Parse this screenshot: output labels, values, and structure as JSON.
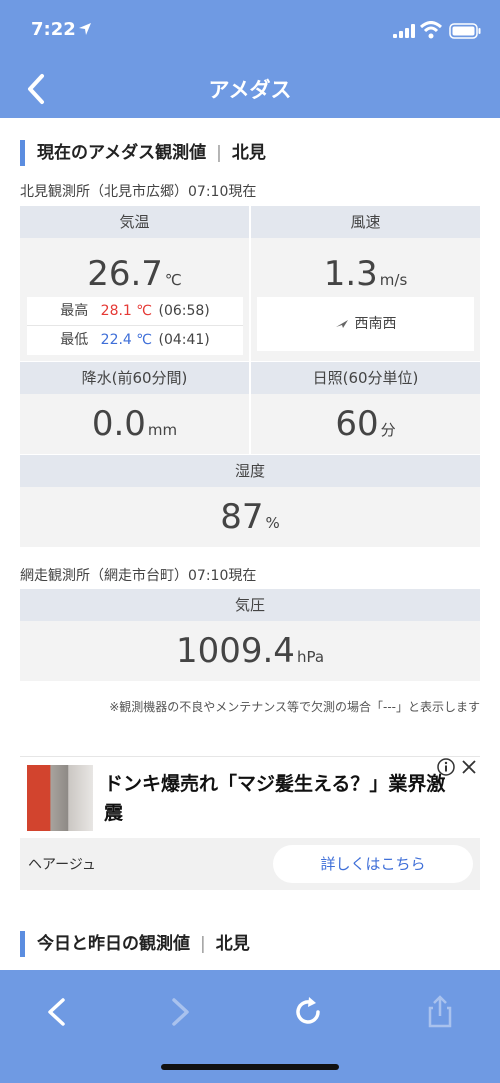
{
  "status_bar": {
    "time": "7:22"
  },
  "nav": {
    "title": "アメダス"
  },
  "current": {
    "heading": "現在のアメダス観測値",
    "separator": "|",
    "city": "北見",
    "station": "北見観測所（北見市広郷）07:10現在",
    "temperature": {
      "label": "気温",
      "value": "26.7",
      "unit": "℃",
      "high_label": "最高",
      "high_value": "28.1 ℃",
      "high_time": "(06:58)",
      "low_label": "最低",
      "low_value": "22.4 ℃",
      "low_time": "(04:41)"
    },
    "wind": {
      "label": "風速",
      "value": "1.3",
      "unit": "m/s",
      "direction": "西南西"
    },
    "precip": {
      "label": "降水(前60分間)",
      "value": "0.0",
      "unit": "mm"
    },
    "sunshine": {
      "label": "日照(60分単位)",
      "value": "60",
      "unit": "分"
    },
    "humidity": {
      "label": "湿度",
      "value": "87",
      "unit": "%"
    },
    "pressure_station": "網走観測所（網走市台町）07:10現在",
    "pressure": {
      "label": "気圧",
      "value": "1009.4",
      "unit": "hPa"
    },
    "note": "※観測機器の不良やメンテナンス等で欠測の場合「---」と表示します"
  },
  "ad": {
    "headline": "ドンキ爆売れ「マジ髪生える？」業界激震",
    "advertiser": "ヘアージュ",
    "cta": "詳しくはこちら"
  },
  "history": {
    "heading": "今日と昨日の観測値",
    "separator": "|",
    "city": "北見"
  },
  "colors": {
    "accent": "#6f9ae3",
    "high": "#e53935",
    "low": "#3f6fd8"
  }
}
